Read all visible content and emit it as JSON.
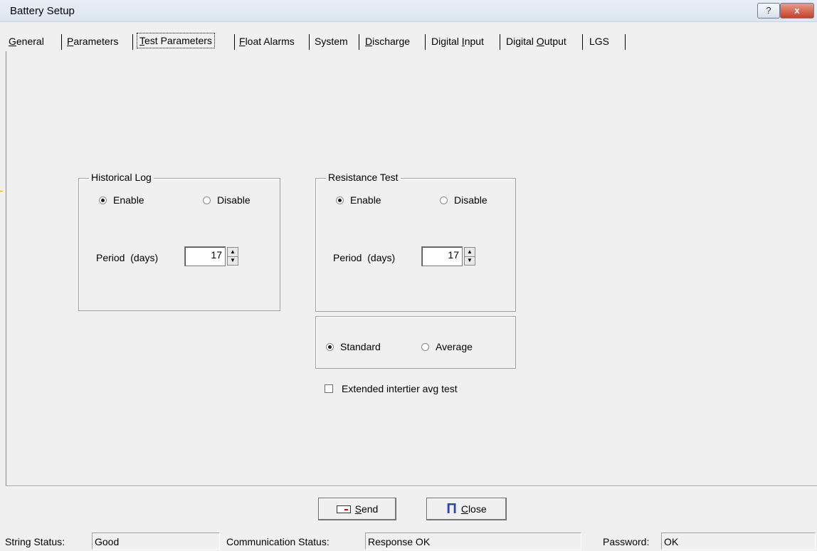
{
  "window": {
    "title": "Battery Setup",
    "help_glyph": "?",
    "close_glyph": "x"
  },
  "tabs": [
    {
      "prefix": "",
      "key": "G",
      "rest": "eneral"
    },
    {
      "prefix": "",
      "key": "P",
      "rest": "arameters"
    },
    {
      "prefix": "",
      "key": "T",
      "rest": "est Parameters"
    },
    {
      "prefix": "",
      "key": "F",
      "rest": "loat Alarms"
    },
    {
      "prefix": "System",
      "key": "",
      "rest": ""
    },
    {
      "prefix": "",
      "key": "D",
      "rest": "ischarge"
    },
    {
      "prefix": "Digital ",
      "key": "I",
      "rest": "nput"
    },
    {
      "prefix": "Digital ",
      "key": "O",
      "rest": "utput"
    },
    {
      "prefix": "LGS",
      "key": "",
      "rest": ""
    }
  ],
  "historical_log": {
    "title": "Historical Log",
    "enable_label": "Enable",
    "disable_label": "Disable",
    "selected": "enable",
    "period_label": "Period  (days)",
    "period_value": "17"
  },
  "resistance_test": {
    "title": "Resistance Test",
    "enable_label": "Enable",
    "disable_label": "Disable",
    "selected": "enable",
    "period_label": "Period  (days)",
    "period_value": "17"
  },
  "mode": {
    "standard_label": "Standard",
    "average_label": "Average",
    "selected": "standard"
  },
  "extended_checkbox": {
    "label": "Extended intertier avg test",
    "checked": false
  },
  "buttons": {
    "send": {
      "key": "S",
      "rest": "end"
    },
    "close": {
      "key": "C",
      "rest": "lose"
    }
  },
  "status": {
    "string_label": "String Status:",
    "string_value": "Good",
    "comm_label": "Communication Status:",
    "comm_value": "Response OK",
    "password_label": "Password:",
    "password_value": "OK"
  },
  "icons": [
    "help-icon",
    "window-close-icon",
    "send-icon",
    "close-door-icon",
    "spin-up-icon",
    "spin-down-icon"
  ]
}
